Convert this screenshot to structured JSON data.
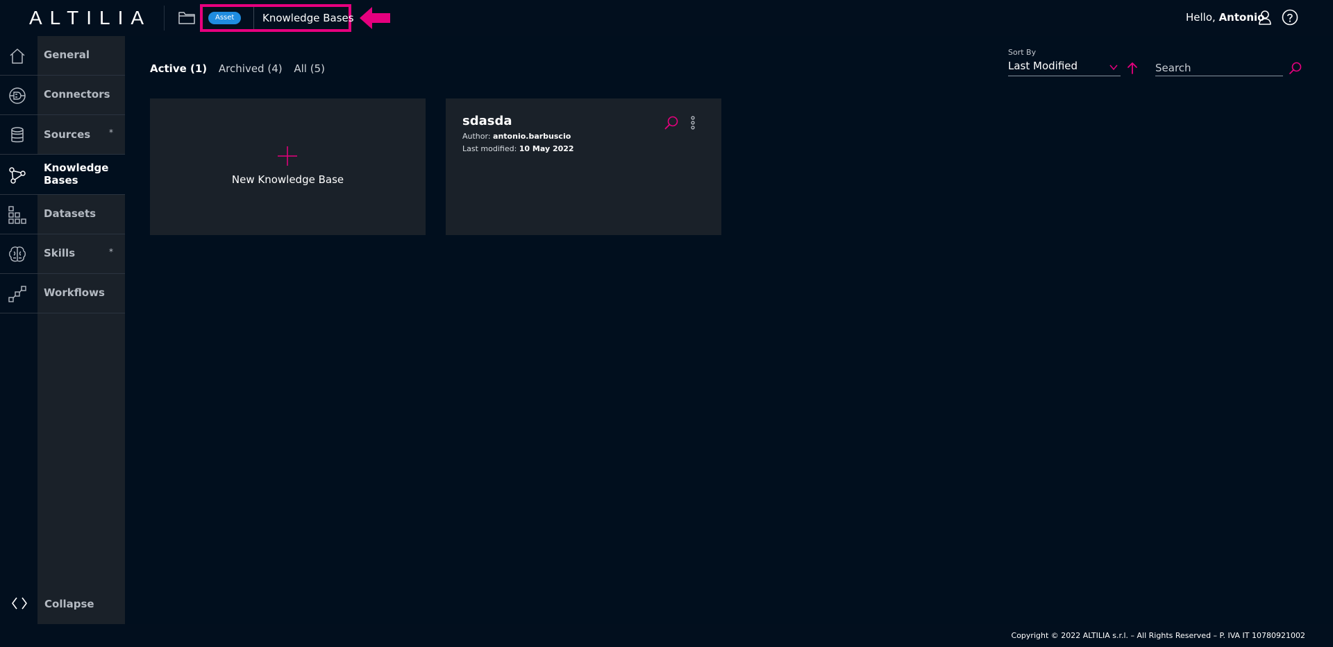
{
  "app": {
    "logo": "ALTILIA"
  },
  "header": {
    "badge": "Asset",
    "breadcrumb": "Knowledge Bases",
    "greeting_prefix": "Hello, ",
    "user_name": "Antonio",
    "highlight_color": "#e6007e",
    "badge_color": "#1f8ce0"
  },
  "sidebar": {
    "items": [
      {
        "label": "General",
        "icon": "home-icon"
      },
      {
        "label": "Connectors",
        "icon": "connector-icon"
      },
      {
        "label": "Sources",
        "icon": "database-icon",
        "marker": "*"
      },
      {
        "label": "Knowledge Bases",
        "icon": "graph-icon",
        "active": true
      },
      {
        "label": "Datasets",
        "icon": "grid-icon"
      },
      {
        "label": "Skills",
        "icon": "brain-icon",
        "marker": "*"
      },
      {
        "label": "Workflows",
        "icon": "workflow-icon"
      }
    ],
    "collapse_label": "Collapse"
  },
  "tabs": [
    {
      "label": "Active (1)",
      "active": true
    },
    {
      "label": "Archived (4)"
    },
    {
      "label": "All (5)"
    }
  ],
  "sort": {
    "label": "Sort By",
    "value": "Last Modified"
  },
  "search": {
    "placeholder": "Search"
  },
  "new_card": {
    "label": "New Knowledge Base"
  },
  "kb_cards": [
    {
      "title": "sdasda",
      "author_label": "Author:",
      "author": "antonio.barbuscio",
      "modified_label": "Last modified:",
      "modified": "10 May 2022"
    }
  ],
  "footer": {
    "text": "Copyright © 2022 ALTILIA s.r.l. – All Rights Reserved – P. IVA IT 10780921002"
  }
}
